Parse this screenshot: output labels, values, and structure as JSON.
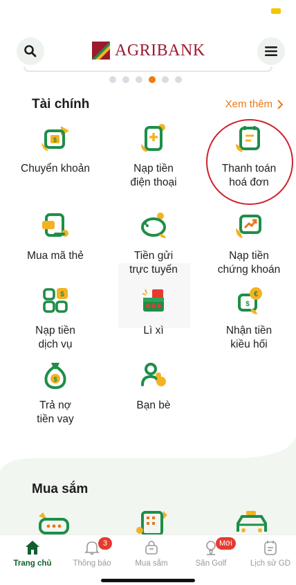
{
  "header": {
    "logo_text": "AGRIBANK"
  },
  "carousel": {
    "dot_count": 6,
    "active_index": 3
  },
  "finance": {
    "title": "Tài chính",
    "see_more": "Xem thêm",
    "items": [
      {
        "label": "Chuyển khoản",
        "icon": "transfer-icon"
      },
      {
        "label": "Nạp tiền\nđiện thoại",
        "icon": "phone-topup-icon"
      },
      {
        "label": "Thanh toán\nhoá đơn",
        "icon": "bill-payment-icon"
      },
      {
        "label": "Mua mã thẻ",
        "icon": "card-code-icon"
      },
      {
        "label": "Tiền gửi\ntrực tuyến",
        "icon": "piggy-bank-icon"
      },
      {
        "label": "Nạp tiền\nchứng khoán",
        "icon": "stock-topup-icon"
      },
      {
        "label": "Nạp tiền\ndịch vụ",
        "icon": "service-topup-icon"
      },
      {
        "label": "Lì xì",
        "icon": "lucky-money-icon"
      },
      {
        "label": "Nhận tiền\nkiều hối",
        "icon": "remittance-icon"
      },
      {
        "label": "Trả nợ\ntiền vay",
        "icon": "loan-repay-icon"
      },
      {
        "label": "Bạn bè",
        "icon": "friends-icon"
      }
    ]
  },
  "shopping": {
    "title": "Mua sắm"
  },
  "tabbar": {
    "items": [
      {
        "label": "Trang chủ",
        "icon": "home-icon"
      },
      {
        "label": "Thông báo",
        "icon": "bell-icon",
        "badge": "3"
      },
      {
        "label": "Mua sắm",
        "icon": "shopping-bag-icon"
      },
      {
        "label": "Sân Golf",
        "icon": "golf-icon",
        "badge": "Mới"
      },
      {
        "label": "Lịch sử GD",
        "icon": "history-icon"
      }
    ]
  },
  "colors": {
    "brand_green": "#11602e",
    "icon_green": "#1e8e48",
    "accent_orange": "#e87818",
    "icon_yellow": "#f4b223",
    "brand_red": "#9c1a2e"
  }
}
